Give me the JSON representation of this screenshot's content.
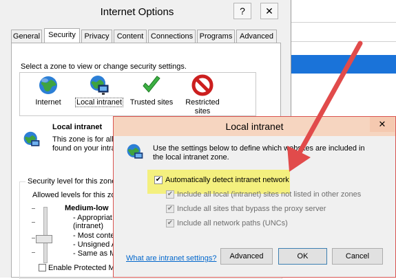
{
  "internet_options": {
    "title": "Internet Options",
    "help_btn": "?",
    "close_btn": "✕",
    "tabs": [
      "General",
      "Security",
      "Privacy",
      "Content",
      "Connections",
      "Programs",
      "Advanced"
    ],
    "active_tab": "Security",
    "zone_prompt": "Select a zone to view or change security settings.",
    "zones": [
      {
        "label": "Internet",
        "icon": "globe-icon"
      },
      {
        "label": "Local intranet",
        "icon": "intranet-icon"
      },
      {
        "label": "Trusted sites",
        "icon": "checkmark-icon"
      },
      {
        "label": "Restricted sites",
        "icon": "restricted-icon"
      }
    ],
    "zone_heading": "Local intranet",
    "zone_desc_line1": "This zone is for all",
    "zone_desc_line2": "found on your intra",
    "security_level_label": "Security level for this zone",
    "allowed_levels": "Allowed levels for this zo",
    "level_name": "Medium-low",
    "bullets": [
      "- Appropriat",
      "(intranet)",
      "- Most conte",
      "- Unsigned A",
      "- Same as M"
    ],
    "protected_mode": "Enable Protected M"
  },
  "local_intranet": {
    "title": "Local intranet",
    "close_btn": "✕",
    "description_line1": "Use the settings below to define which websites are included in",
    "description_line2": "the local intranet zone.",
    "options": [
      {
        "label": "Automatically detect intranet network",
        "checked": true,
        "enabled": true
      },
      {
        "label": "Include all local (intranet) sites not listed in other zones",
        "checked": true,
        "enabled": false
      },
      {
        "label": "Include all sites that bypass the proxy server",
        "checked": true,
        "enabled": false
      },
      {
        "label": "Include all network paths (UNCs)",
        "checked": true,
        "enabled": false
      }
    ],
    "help_link": "What are intranet settings?",
    "buttons": {
      "advanced": "Advanced",
      "ok": "OK",
      "cancel": "Cancel"
    }
  },
  "colors": {
    "highlight": "#f4f06a",
    "arrow": "#e14b4b",
    "link": "#0066cc",
    "accent_blue": "#1a73d9"
  }
}
